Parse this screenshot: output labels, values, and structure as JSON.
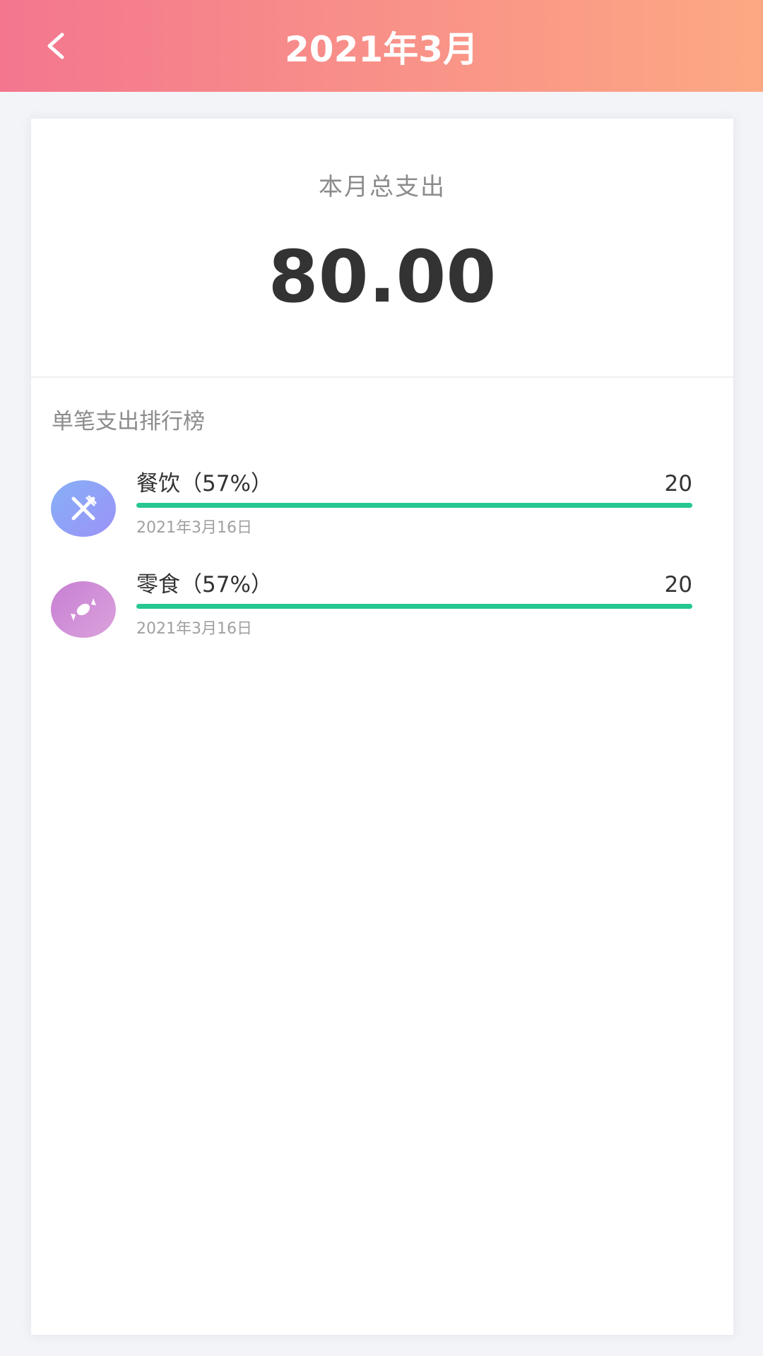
{
  "header": {
    "title": "2021年3月",
    "back_icon": "chevron-left-icon"
  },
  "summary": {
    "label": "本月总支出",
    "amount": "80.00"
  },
  "ranking": {
    "title": "单笔支出排行榜",
    "items": [
      {
        "name": "餐饮（57%）",
        "value": "20",
        "date": "2021年3月16日",
        "icon": "fork-knife-icon",
        "icon_color": "#8fa0f8",
        "bar_color": "#26c791",
        "bar_fraction": 1.0
      },
      {
        "name": "零食（57%）",
        "value": "20",
        "date": "2021年3月16日",
        "icon": "candy-icon",
        "icon_color": "#cf8dd6",
        "bar_color": "#26c791",
        "bar_fraction": 1.0
      }
    ]
  },
  "colors": {
    "header_gradient_start": "#f3768e",
    "header_gradient_end": "#fda883",
    "accent_green": "#26c791"
  }
}
